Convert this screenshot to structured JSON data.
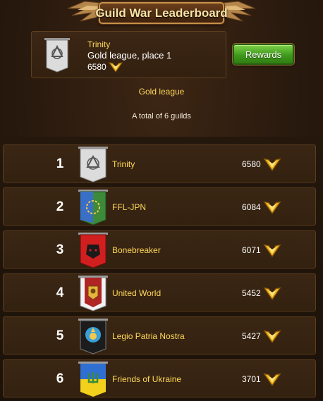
{
  "header": {
    "title": "Guild War Leaderboard"
  },
  "my_guild": {
    "name": "Trinity",
    "place_text": "Gold league, place 1",
    "score": "6580",
    "rewards_label": "Rewards"
  },
  "league_label": "Gold league",
  "total_label": "A total of 6 guilds",
  "colors": {
    "gold_text": "#ffd85a",
    "rewards_green": "#4fb025",
    "panel_bg": "#3b2614"
  },
  "guilds": [
    {
      "rank": "1",
      "name": "Trinity",
      "score": "6580",
      "emblem": "triquetra-icon"
    },
    {
      "rank": "2",
      "name": "FFL-JPN",
      "score": "6084",
      "emblem": "laurel-wreath-icon"
    },
    {
      "rank": "3",
      "name": "Bonebreaker",
      "score": "6071",
      "emblem": "beast-head-icon"
    },
    {
      "rank": "4",
      "name": "United World",
      "score": "5452",
      "emblem": "lion-shield-icon"
    },
    {
      "rank": "5",
      "name": "Legio Patria Nostra",
      "score": "5427",
      "emblem": "grenade-icon"
    },
    {
      "rank": "6",
      "name": "Friends of Ukraine",
      "score": "3701",
      "emblem": "trident-icon"
    }
  ]
}
